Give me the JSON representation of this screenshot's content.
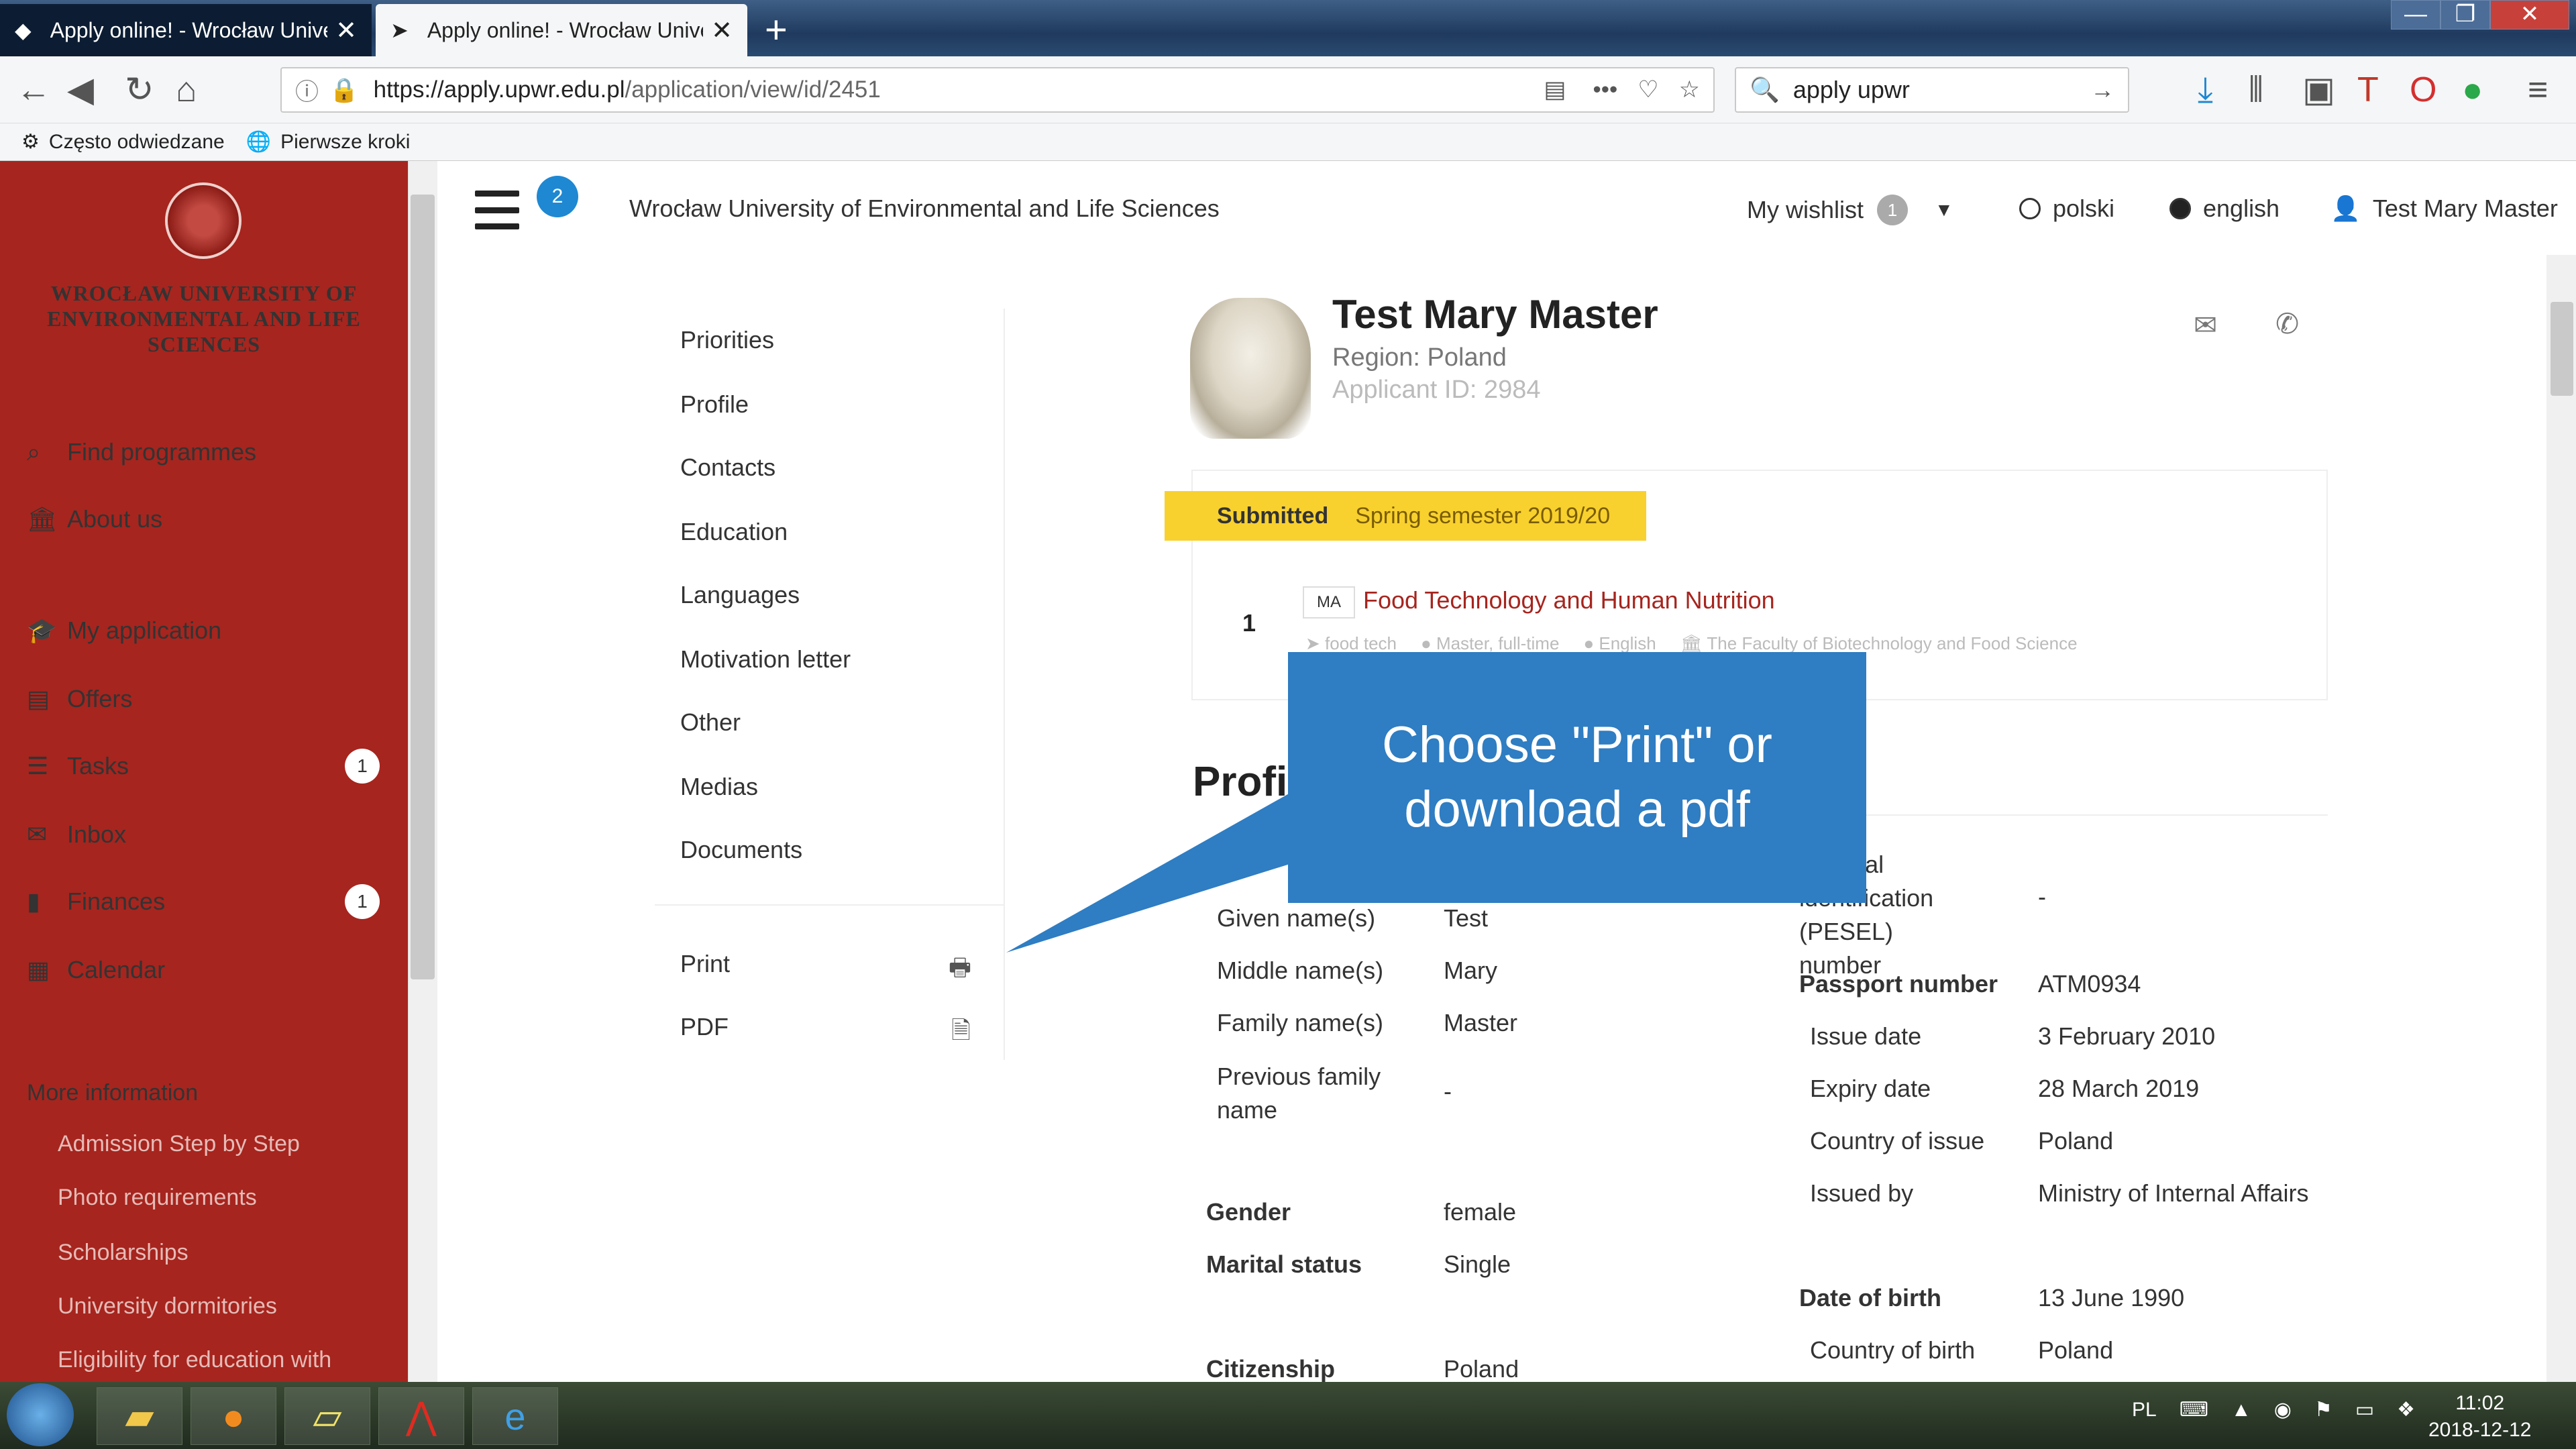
{
  "browser": {
    "tabs": [
      {
        "label": "Apply online! - Wrocław Univer",
        "active": false
      },
      {
        "label": "Apply online! - Wrocław Unive",
        "active": true
      }
    ],
    "new_tab": "+",
    "url_host": "https://apply.upwr.edu.pl",
    "url_path": "/application/view/id/2451",
    "search_value": "apply upwr",
    "bookmarks": [
      "Często odwiedzane",
      "Pierwsze kroki"
    ],
    "window_buttons": [
      "—",
      "❐",
      "✕"
    ]
  },
  "sidebar": {
    "university_name": "Wrocław University of Environmental and Life Sciences",
    "items": [
      {
        "label": "Find programmes",
        "icon": "search-icon",
        "badge": null
      },
      {
        "label": "About us",
        "icon": "building-icon",
        "badge": null
      },
      {
        "label": "My application",
        "icon": "graduation-cap-icon",
        "badge": null
      },
      {
        "label": "Offers",
        "icon": "document-icon",
        "badge": null
      },
      {
        "label": "Tasks",
        "icon": "tasks-icon",
        "badge": "1"
      },
      {
        "label": "Inbox",
        "icon": "inbox-icon",
        "badge": null
      },
      {
        "label": "Finances",
        "icon": "file-icon",
        "badge": "1"
      },
      {
        "label": "Calendar",
        "icon": "calendar-icon",
        "badge": null
      }
    ],
    "more_info_title": "More information",
    "more_info_links": [
      "Admission Step by Step",
      "Photo requirements",
      "Scholarships",
      "University dormitories",
      "Eligibility for education with"
    ]
  },
  "header": {
    "notification_count": "2",
    "title": "Wrocław University of Environmental and Life Sciences",
    "wishlist_label": "My wishlist",
    "wishlist_count": "1",
    "languages": [
      {
        "label": "polski",
        "selected": false
      },
      {
        "label": "english",
        "selected": true
      }
    ],
    "user_name": "Test Mary Master"
  },
  "section_menu": {
    "items": [
      "Priorities",
      "Profile",
      "Contacts",
      "Education",
      "Languages",
      "Motivation letter",
      "Other",
      "Medias",
      "Documents"
    ],
    "print_label": "Print",
    "pdf_label": "PDF"
  },
  "applicant": {
    "name": "Test Mary Master",
    "region": "Region: Poland",
    "applicant_id": "Applicant ID: 2984",
    "status": "Submitted",
    "semester": "Spring semester 2019/20",
    "programme": {
      "number": "1",
      "degree": "MA",
      "name": "Food Technology and Human Nutrition",
      "tags": [
        "food tech",
        "Master, full-time",
        "English",
        "The Faculty of Biotechnology and Food Science"
      ]
    }
  },
  "profile": {
    "title": "Profile",
    "left_fields": [
      {
        "label": "Given name(s)",
        "value": "Test"
      },
      {
        "label": "Middle name(s)",
        "value": "Mary"
      },
      {
        "label": "Family name(s)",
        "value": "Master"
      },
      {
        "label": "Previous family name",
        "value": "-"
      },
      {
        "label": "Gender",
        "value": "female"
      },
      {
        "label": "Marital status",
        "value": "Single"
      },
      {
        "label": "Citizenship",
        "value": "Poland"
      }
    ],
    "national_id_label": "national identification (PESEL) number",
    "national_id_value": "-",
    "passport_label": "Passport number",
    "passport_value": "ATM0934",
    "passport_fields": [
      {
        "label": "Issue date",
        "value": "3 February 2010"
      },
      {
        "label": "Expiry date",
        "value": "28 March 2019"
      },
      {
        "label": "Country of issue",
        "value": "Poland"
      },
      {
        "label": "Issued by",
        "value": "Ministry of Internal Affairs"
      }
    ],
    "dob_label": "Date of birth",
    "dob_value": "13 June 1990",
    "birth_country_label": "Country of birth",
    "birth_country_value": "Poland"
  },
  "callout": {
    "text": "Choose \"Print\" or download a pdf"
  },
  "taskbar": {
    "language": "PL",
    "time": "11:02",
    "date": "2018-12-12"
  },
  "colors": {
    "sidebar": "#a6251e",
    "accent_blue": "#1e88d3",
    "status_yellow": "#f8d12f",
    "callout_blue": "#2f7dc2"
  }
}
